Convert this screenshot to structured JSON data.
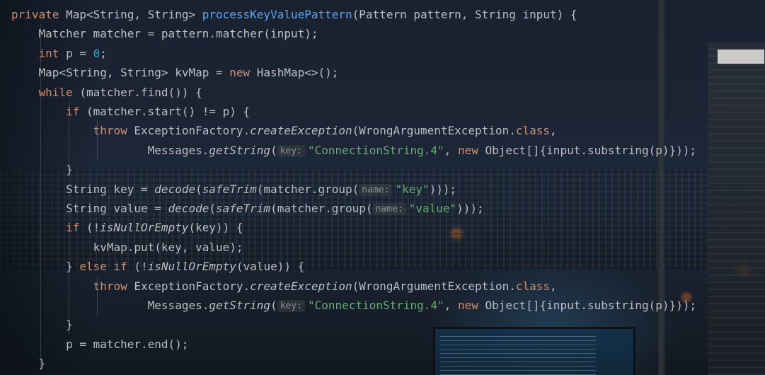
{
  "editor": {
    "theme_colors": {
      "default": "#bcbec4",
      "keyword": "#cf8e6d",
      "method_decl": "#56a8f5",
      "number": "#2aacb8",
      "string": "#6aab73",
      "inlay_hint": "#8c8f94"
    },
    "lines": [
      {
        "tokens": [
          {
            "t": "private",
            "c": "kw"
          },
          {
            "t": " Map<String, String> "
          },
          {
            "t": "processKeyValuePattern",
            "c": "fn"
          },
          {
            "t": "(Pattern pattern, String input) {"
          }
        ]
      },
      {
        "tokens": [
          {
            "t": "    Matcher matcher = pattern.matcher(input);"
          }
        ]
      },
      {
        "tokens": [
          {
            "t": "    "
          },
          {
            "t": "int",
            "c": "kw"
          },
          {
            "t": " p = "
          },
          {
            "t": "0",
            "c": "num"
          },
          {
            "t": ";"
          }
        ]
      },
      {
        "tokens": [
          {
            "t": "    Map<String, String> kvMap = "
          },
          {
            "t": "new",
            "c": "kw"
          },
          {
            "t": " HashMap<>();"
          }
        ]
      },
      {
        "tokens": [
          {
            "t": "    "
          },
          {
            "t": "while",
            "c": "kw"
          },
          {
            "t": " (matcher.find()) {"
          }
        ]
      },
      {
        "tokens": [
          {
            "t": "        "
          },
          {
            "t": "if",
            "c": "kw"
          },
          {
            "t": " (matcher.start() != p) {"
          }
        ]
      },
      {
        "tokens": [
          {
            "t": "            "
          },
          {
            "t": "throw",
            "c": "kw"
          },
          {
            "t": " ExceptionFactory."
          },
          {
            "t": "createException",
            "c": "it"
          },
          {
            "t": "(WrongArgumentException."
          },
          {
            "t": "class",
            "c": "kw"
          },
          {
            "t": ","
          }
        ]
      },
      {
        "tokens": [
          {
            "t": "                    Messages."
          },
          {
            "t": "getString",
            "c": "it"
          },
          {
            "t": "("
          },
          {
            "t": "key:",
            "c": "hint"
          },
          {
            "t": "\"ConnectionString.4\"",
            "c": "str"
          },
          {
            "t": ", "
          },
          {
            "t": "new",
            "c": "kw"
          },
          {
            "t": " Object[]{input.substring(p)}));"
          }
        ]
      },
      {
        "tokens": [
          {
            "t": "        }"
          }
        ]
      },
      {
        "tokens": [
          {
            "t": "        String key = "
          },
          {
            "t": "decode",
            "c": "it"
          },
          {
            "t": "("
          },
          {
            "t": "safeTrim",
            "c": "it"
          },
          {
            "t": "(matcher.group("
          },
          {
            "t": "name:",
            "c": "hint"
          },
          {
            "t": "\"key\"",
            "c": "str"
          },
          {
            "t": ")));"
          }
        ]
      },
      {
        "tokens": [
          {
            "t": "        String value = "
          },
          {
            "t": "decode",
            "c": "it"
          },
          {
            "t": "("
          },
          {
            "t": "safeTrim",
            "c": "it"
          },
          {
            "t": "(matcher.group("
          },
          {
            "t": "name:",
            "c": "hint"
          },
          {
            "t": "\"value\"",
            "c": "str"
          },
          {
            "t": ")));"
          }
        ]
      },
      {
        "tokens": [
          {
            "t": "        "
          },
          {
            "t": "if",
            "c": "kw"
          },
          {
            "t": " (!"
          },
          {
            "t": "isNullOrEmpty",
            "c": "it"
          },
          {
            "t": "(key)) {"
          }
        ]
      },
      {
        "tokens": [
          {
            "t": "            kvMap.put(key, value);"
          }
        ]
      },
      {
        "tokens": [
          {
            "t": "        } "
          },
          {
            "t": "else if",
            "c": "kw"
          },
          {
            "t": " (!"
          },
          {
            "t": "isNullOrEmpty",
            "c": "it"
          },
          {
            "t": "(value)) {"
          }
        ]
      },
      {
        "tokens": [
          {
            "t": "            "
          },
          {
            "t": "throw",
            "c": "kw"
          },
          {
            "t": " ExceptionFactory."
          },
          {
            "t": "createException",
            "c": "it"
          },
          {
            "t": "(WrongArgumentException."
          },
          {
            "t": "class",
            "c": "kw"
          },
          {
            "t": ","
          }
        ]
      },
      {
        "tokens": [
          {
            "t": "                    Messages."
          },
          {
            "t": "getString",
            "c": "it"
          },
          {
            "t": "("
          },
          {
            "t": "key:",
            "c": "hint"
          },
          {
            "t": "\"ConnectionString.4\"",
            "c": "str"
          },
          {
            "t": ", "
          },
          {
            "t": "new",
            "c": "kw"
          },
          {
            "t": " Object[]{input.substring(p)}));"
          }
        ]
      },
      {
        "tokens": [
          {
            "t": "        }"
          }
        ]
      },
      {
        "tokens": [
          {
            "t": "        p = matcher.end();"
          }
        ]
      },
      {
        "tokens": [
          {
            "t": "    }"
          }
        ]
      }
    ]
  }
}
